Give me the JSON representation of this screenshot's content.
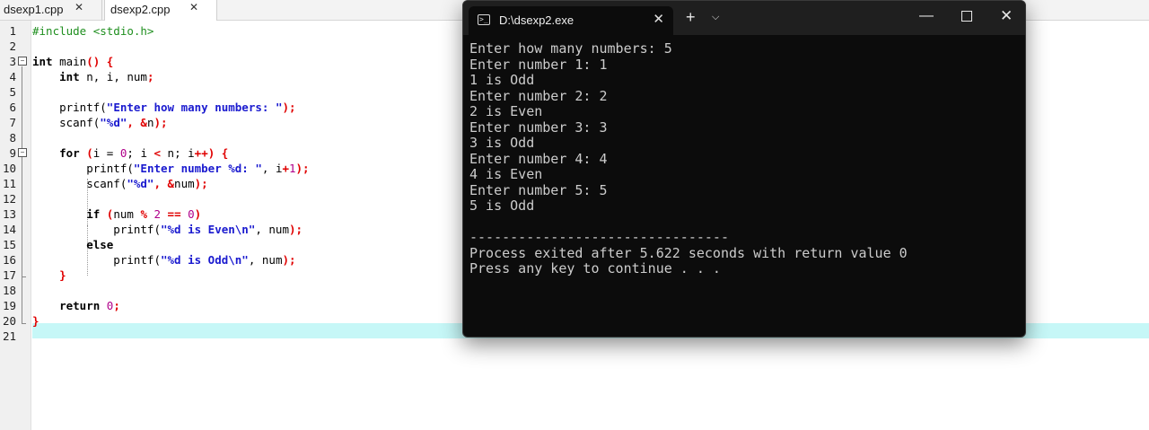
{
  "editor": {
    "tabs": [
      {
        "label": "dsexp1.cpp",
        "close": "✕"
      },
      {
        "label": "dsexp2.cpp",
        "close": "✕"
      }
    ],
    "line_numbers": [
      "1",
      "2",
      "3",
      "4",
      "5",
      "6",
      "7",
      "8",
      "9",
      "10",
      "11",
      "12",
      "13",
      "14",
      "15",
      "16",
      "17",
      "18",
      "19",
      "20",
      "21"
    ],
    "code": {
      "l1_a": "#include <stdio.h>",
      "l3_a": "int",
      "l3_b": " main",
      "l3_c": "() {",
      "l4_a": "    int",
      "l4_b": " n, i, num",
      "l4_c": ";",
      "l6_a": "    printf(",
      "l6_b": "\"Enter how many numbers: \"",
      "l6_c": ");",
      "l7_a": "    scanf(",
      "l7_b": "\"%d\"",
      "l7_c": ", &",
      "l7_d": "n",
      "l7_e": ");",
      "l9_a": "    for",
      "l9_b": " (",
      "l9_c": "i = ",
      "l9_d": "0",
      "l9_e": "; i ",
      "l9_f": "<",
      "l9_g": " n; i",
      "l9_h": "++",
      "l9_i": ") {",
      "l10_a": "        printf(",
      "l10_b": "\"Enter number %d: \"",
      "l10_c": ", i",
      "l10_d": "+",
      "l10_e": "1",
      "l10_f": ");",
      "l11_a": "        scanf(",
      "l11_b": "\"%d\"",
      "l11_c": ", &",
      "l11_d": "num",
      "l11_e": ");",
      "l13_a": "        if",
      "l13_b": " (",
      "l13_c": "num ",
      "l13_d": "%",
      "l13_e": " ",
      "l13_f": "2",
      "l13_g": " == ",
      "l13_h": "0",
      "l13_i": ")",
      "l14_a": "            printf(",
      "l14_b": "\"%d is Even\\n\"",
      "l14_c": ", num",
      "l14_d": ");",
      "l15_a": "        else",
      "l16_a": "            printf(",
      "l16_b": "\"%d is Odd\\n\"",
      "l16_c": ", num",
      "l16_d": ");",
      "l17_a": "    }",
      "l19_a": "    return",
      "l19_b": " ",
      "l19_c": "0",
      "l19_d": ";",
      "l20_a": "}"
    },
    "fold_markers": [
      "−",
      "−"
    ]
  },
  "terminal": {
    "title": "D:\\dsexp2.exe",
    "tab_close": "✕",
    "new_tab": "+",
    "dropdown": "⌵",
    "minimize": "—",
    "close": "✕",
    "icon_glyph": ">_",
    "lines": [
      "Enter how many numbers: 5",
      "Enter number 1: 1",
      "1 is Odd",
      "Enter number 2: 2",
      "2 is Even",
      "Enter number 3: 3",
      "3 is Odd",
      "Enter number 4: 4",
      "4 is Even",
      "Enter number 5: 5",
      "5 is Odd",
      "",
      "--------------------------------",
      "Process exited after 5.622 seconds with return value 0",
      "Press any key to continue . . ."
    ]
  },
  "colors": {
    "current_line": "#c6f7f7",
    "terminal_bg": "#0c0c0c",
    "string": "#1a1acf",
    "number": "#b0008a",
    "symbol": "#e00000",
    "preprocessor": "#1f8f1f"
  }
}
